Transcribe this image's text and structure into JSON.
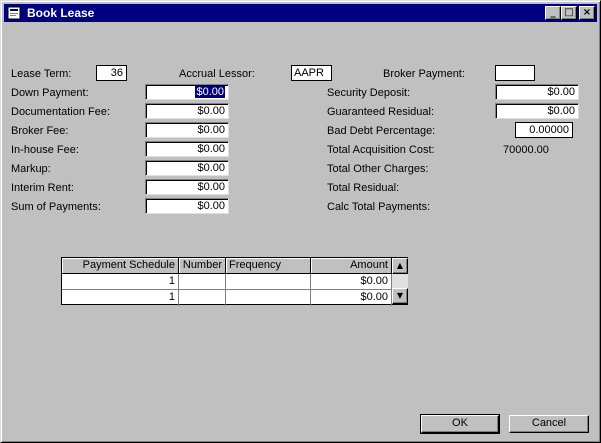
{
  "window": {
    "title": "Book Lease"
  },
  "titlebar_buttons": {
    "minimize": "_",
    "maximize": "□",
    "close": "×"
  },
  "left": {
    "lease_term": {
      "label": "Lease Term:",
      "value": "36"
    },
    "accrual_lessor": {
      "label": "Accrual Lessor:",
      "value": "AAPR"
    },
    "down_payment": {
      "label": "Down Payment:",
      "value": "$0.00"
    },
    "documentation_fee": {
      "label": "Documentation Fee:",
      "value": "$0.00"
    },
    "broker_fee": {
      "label": "Broker Fee:",
      "value": "$0.00"
    },
    "in_house_fee": {
      "label": "In-house Fee:",
      "value": "$0.00"
    },
    "markup": {
      "label": "Markup:",
      "value": "$0.00"
    },
    "interim_rent": {
      "label": "Interim Rent:",
      "value": "$0.00"
    },
    "sum_of_payments": {
      "label": "Sum of Payments:",
      "value": "$0.00"
    }
  },
  "right": {
    "broker_payment": {
      "label": "Broker Payment:",
      "value": ""
    },
    "security_deposit": {
      "label": "Security Deposit:",
      "value": "$0.00"
    },
    "guaranteed_residual": {
      "label": "Guaranteed Residual:",
      "value": "$0.00"
    },
    "bad_debt_percentage": {
      "label": "Bad Debt Percentage:",
      "value": "0.00000"
    },
    "total_acquisition_cost": {
      "label": "Total Acquisition Cost:",
      "value": "70000.00"
    },
    "total_other_charges": {
      "label": "Total Other Charges:",
      "value": ""
    },
    "total_residual": {
      "label": "Total Residual:",
      "value": ""
    },
    "calc_total_payments": {
      "label": "Calc Total Payments:",
      "value": ""
    }
  },
  "grid": {
    "columns": [
      "Payment Schedule",
      "Number",
      "Frequency",
      "Amount"
    ],
    "rows": [
      [
        "1",
        "",
        "",
        "$0.00"
      ],
      [
        "1",
        "",
        "",
        "$0.00"
      ]
    ],
    "scroll_up": "▲",
    "scroll_down": "▼"
  },
  "buttons": {
    "ok": "OK",
    "cancel": "Cancel"
  },
  "colors": {
    "titlebar": "#000080",
    "face": "#c0c0c0",
    "selection": "#000080"
  }
}
